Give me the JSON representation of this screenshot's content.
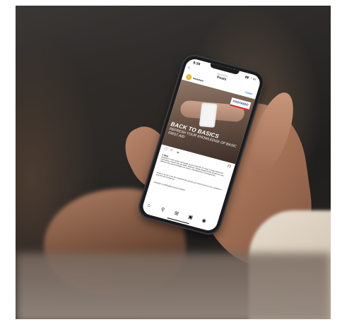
{
  "status": {
    "time": "8:36"
  },
  "nav": {
    "subtitle": "FIRSTAIDPRO",
    "title": "Posts",
    "back": "‹"
  },
  "post": {
    "username": "fastaidpro",
    "follow_label": "Follow",
    "brand": "FASTAIDO",
    "headline": "BACK TO BASICS",
    "subheadline": "REFRESH YOUR KNOWLEDGE OF BASIC FIRST AID",
    "likes": "2 likes",
    "caption": "fastaidpro In the hustle and bustle of your busy life, it's easy to forget about the importance of basic first aid skills. However, being equipped with simple but very effective first aid knowledge can make a big difference in emergencies.",
    "caption2": "Read on as we cover the essential first aid tips you need to know to be confident in any first aid emergency.",
    "comment": "fastaidpro.com/blog/first-aid-for-children"
  },
  "icons": {
    "heart": "heart-icon",
    "comment": "comment-icon",
    "share": "share-icon",
    "bookmark": "bookmark-icon",
    "home": "home-icon",
    "search": "search-icon",
    "add": "add-post-icon",
    "reels": "reels-icon",
    "profile": "profile-icon"
  }
}
